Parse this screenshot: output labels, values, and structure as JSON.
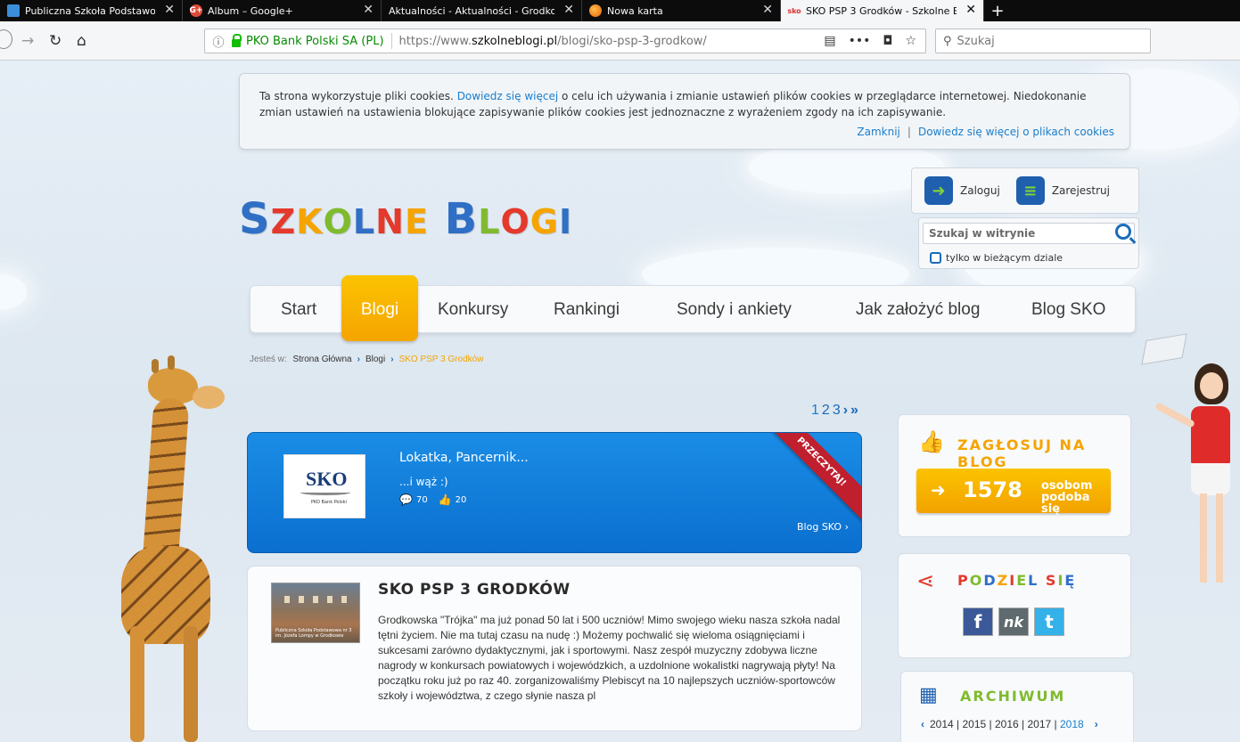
{
  "browser": {
    "tabs": [
      {
        "title": "Publiczna Szkoła Podstawowa n",
        "favicon": "",
        "active": false
      },
      {
        "title": "Album – Google+",
        "favicon": "G+",
        "active": false
      },
      {
        "title": "Aktualności - Aktualności - Grodko",
        "favicon": "",
        "active": false
      },
      {
        "title": "Nowa karta",
        "favicon": "firefox-icon",
        "active": false
      },
      {
        "title": "SKO PSP 3 Grodków - Szkolne B",
        "favicon": "sko",
        "active": true
      }
    ],
    "url_org": "PKO Bank Polski SA (PL)",
    "url_prefix": "https://www.",
    "url_domain": "szkolneblogi.pl",
    "url_path": "/blogi/sko-psp-3-grodkow/",
    "search_placeholder": "Szukaj"
  },
  "cookie": {
    "text1": "Ta strona wykorzystuje pliki cookies.",
    "link1": "Dowiedz się więcej",
    "text2": "o celu ich używania i zmianie ustawień plików cookies w przeglądarce internetowej. Niedokonanie zmian ustawień na ustawienia blokujące zapisywanie plików cookies jest jednoznaczne z wyrażeniem zgody na ich zapisywanie.",
    "close": "Zamknij",
    "more": "Dowiedz się więcej o plikach cookies"
  },
  "logo": [
    "S",
    "Z",
    "K",
    "O",
    "L",
    "N",
    "E",
    " ",
    "B",
    "L",
    "O",
    "G",
    "I"
  ],
  "logo_colors": [
    "#2f6fc5",
    "#e4392b",
    "#f5a400",
    "#7fbb2e",
    "#2f6fc5",
    "#e4392b",
    "#f5a400",
    "",
    "#2f6fc5",
    "#7fbb2e",
    "#e4392b",
    "#f5a400",
    "#2f6fc5"
  ],
  "account": {
    "login": "Zaloguj",
    "register": "Zarejestruj"
  },
  "sitesearch": {
    "placeholder": "Szukaj w witrynie",
    "only_section": "tylko w bieżącym dziale"
  },
  "nav": [
    "Start",
    "Blogi",
    "Konkursy",
    "Rankingi",
    "Sondy i ankiety",
    "Jak założyć blog",
    "Blog SKO"
  ],
  "breadcrumb": {
    "label": "Jesteś w:",
    "items": [
      "Strona Główna",
      "Blogi",
      "SKO PSP 3 Grodków"
    ]
  },
  "pager": {
    "pages": [
      "1",
      "2",
      "3"
    ],
    "next": "›",
    "last": "»"
  },
  "featured": {
    "title": "Lokatka, Pancernik...",
    "lead": "...i wąż :)",
    "comments": "70",
    "likes": "20",
    "blog": "Blog SKO",
    "ribbon": "PRZECZYTAJ!",
    "logo_text": "SKO",
    "logo_sub": "PKO Bank Polski"
  },
  "post": {
    "title": "SKO PSP 3 GRODKÓW",
    "image_caption": "Publiczna Szkoła Podstawowa nr 3 im. Józefa Lompy w Grodkowie",
    "body": "Grodkowska \"Trójka\" ma już ponad 50 lat i 500 uczniów! Mimo swojego wieku nasza szkoła nadal tętni życiem. Nie ma tutaj czasu na nudę :) Możemy pochwalić się wieloma osiągnięciami i sukcesami zarówno dydaktycznymi, jak i sportowymi. Nasz zespół muzyczny zdobywa liczne nagrody w konkursach powiatowych i wojewódzkich, a uzdolnione wokalistki nagrywają płyty! Na początku roku już po raz 40. zorganizowaliśmy Plebiscyt na 10 najlepszych uczniów-sportowców szkoły i województwa, z czego słynie nasza pl"
  },
  "vote": {
    "title": "ZAGŁOSUJ NA BLOG",
    "count": "1578",
    "text1": "osobom",
    "text2": "podoba się"
  },
  "share": {
    "title": "PODZIEL SIĘ",
    "fb": "f",
    "nk": "nk",
    "tw": "t"
  },
  "archive": {
    "title": "ARCHIWUM",
    "years": [
      "2014",
      "2015",
      "2016",
      "2017",
      "2018"
    ]
  },
  "colors": {
    "accent_blue": "#1a7ecb",
    "accent_orange": "#f5a400",
    "ribbon_red": "#c01f2e"
  }
}
